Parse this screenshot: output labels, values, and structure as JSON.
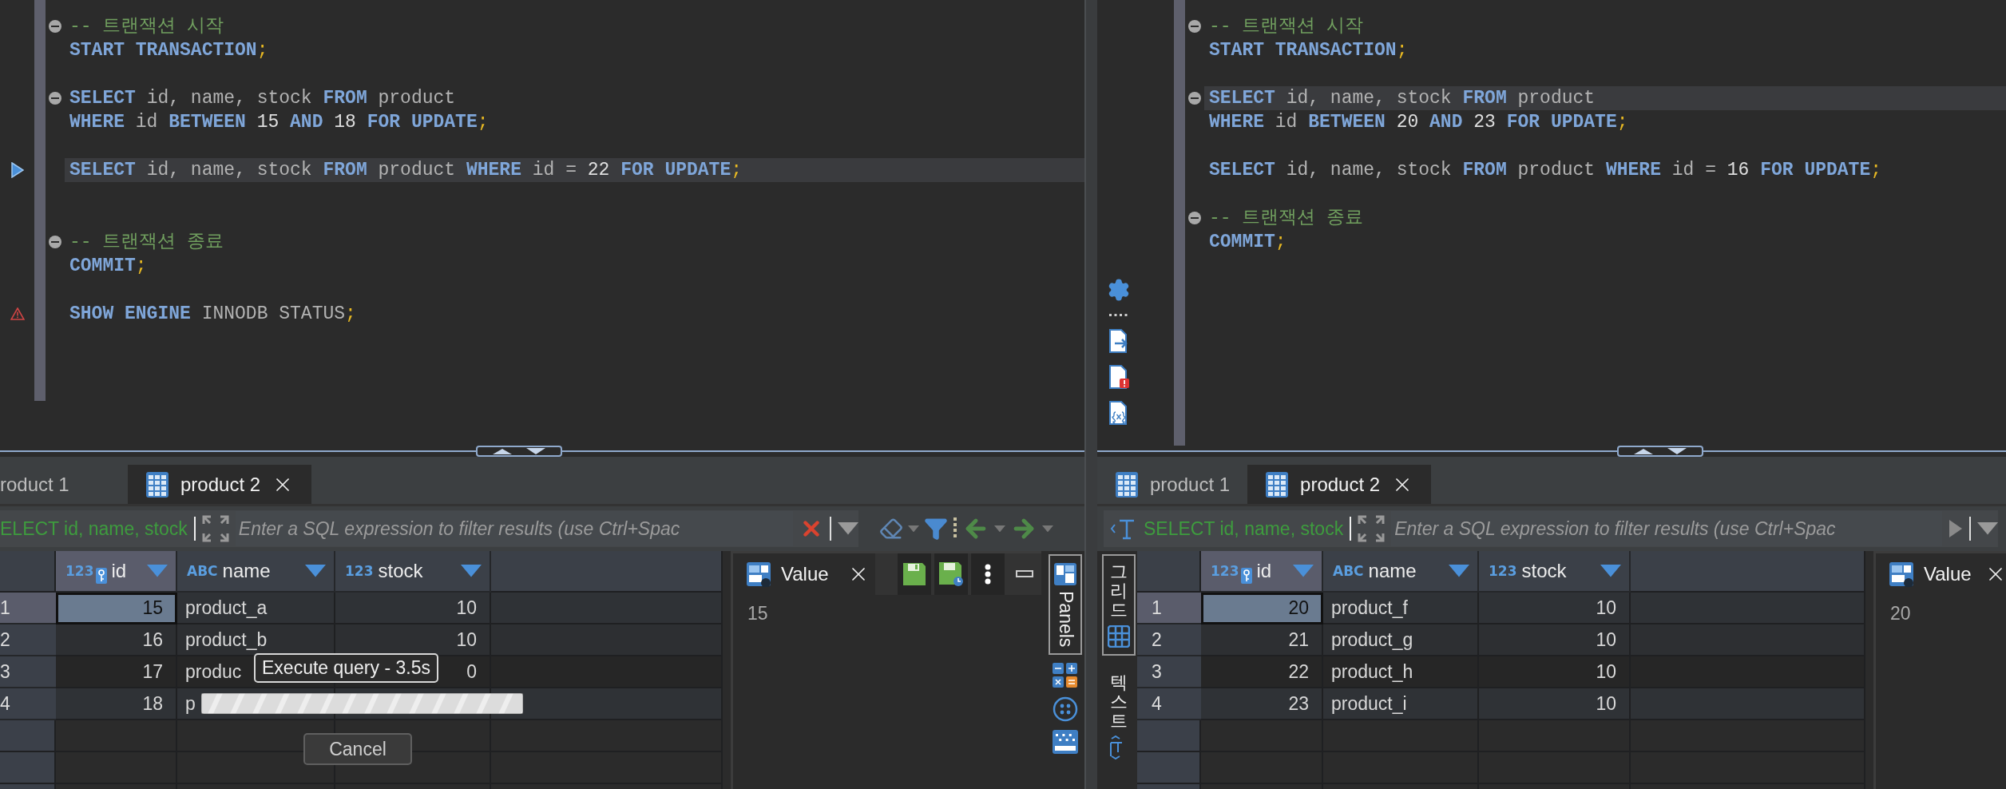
{
  "panes": [
    {
      "editor": {
        "lines": [
          {
            "kind": "code",
            "fold": true,
            "current": false,
            "tokens": [
              {
                "kind": "comment",
                "text": "-- 트랜잭션 시작"
              }
            ]
          },
          {
            "kind": "code",
            "fold": false,
            "current": false,
            "tokens": [
              {
                "kind": "keyword",
                "text": "START TRANSACTION"
              },
              {
                "kind": "punct",
                "text": ";"
              }
            ]
          },
          {
            "kind": "blank"
          },
          {
            "kind": "code",
            "fold": true,
            "current": false,
            "tokens": [
              {
                "kind": "keyword",
                "text": "SELECT"
              },
              {
                "kind": "plain",
                "text": " id, name, stock "
              },
              {
                "kind": "keyword",
                "text": "FROM"
              },
              {
                "kind": "plain",
                "text": " product"
              }
            ]
          },
          {
            "kind": "code",
            "fold": false,
            "current": false,
            "tokens": [
              {
                "kind": "keyword",
                "text": "WHERE"
              },
              {
                "kind": "plain",
                "text": " id "
              },
              {
                "kind": "keyword",
                "text": "BETWEEN "
              },
              {
                "kind": "number",
                "text": "15"
              },
              {
                "kind": "keyword",
                "text": " AND "
              },
              {
                "kind": "number",
                "text": "18"
              },
              {
                "kind": "keyword",
                "text": " FOR UPDATE"
              },
              {
                "kind": "punct",
                "text": ";"
              }
            ]
          },
          {
            "kind": "blank"
          },
          {
            "kind": "code",
            "fold": false,
            "current": true,
            "marker": {
              "kind": "run"
            },
            "tokens": [
              {
                "kind": "keyword",
                "text": "SELECT"
              },
              {
                "kind": "plain",
                "text": " id, name, stock "
              },
              {
                "kind": "keyword",
                "text": "FROM"
              },
              {
                "kind": "plain",
                "text": " product "
              },
              {
                "kind": "keyword",
                "text": "WHERE"
              },
              {
                "kind": "plain",
                "text": " id = "
              },
              {
                "kind": "number",
                "text": "22"
              },
              {
                "kind": "keyword",
                "text": " FOR UPDATE"
              },
              {
                "kind": "punct",
                "text": ";"
              }
            ]
          },
          {
            "kind": "blank"
          },
          {
            "kind": "blank"
          },
          {
            "kind": "code",
            "fold": true,
            "current": false,
            "tokens": [
              {
                "kind": "comment",
                "text": "-- 트랜잭션 종료"
              }
            ]
          },
          {
            "kind": "code",
            "fold": false,
            "current": false,
            "tokens": [
              {
                "kind": "keyword",
                "text": "COMMIT"
              },
              {
                "kind": "punct",
                "text": ";"
              }
            ]
          },
          {
            "kind": "blank"
          },
          {
            "kind": "code",
            "fold": false,
            "current": false,
            "marker": {
              "kind": "warning"
            },
            "tokens": [
              {
                "kind": "keyword",
                "text": "SHOW ENGINE"
              },
              {
                "kind": "plain",
                "text": " INNODB STATUS"
              },
              {
                "kind": "punct",
                "text": ";"
              }
            ]
          }
        ]
      },
      "results": {
        "tabs": [
          {
            "label": "roduct 1",
            "selected": false,
            "icon": false
          },
          {
            "label": "product 2",
            "selected": true,
            "icon": true
          }
        ],
        "filter": {
          "query": "ELECT id, name, stock",
          "placeholder": "Enter a SQL expression to filter results (use Ctrl+Spac",
          "action": {
            "kind": "clear"
          },
          "toolbar": [
            {
              "kind": "eraser"
            },
            {
              "kind": "filter"
            },
            {
              "kind": "more"
            },
            {
              "kind": "back"
            },
            {
              "kind": "forward"
            }
          ]
        },
        "grid": {
          "columns": [
            {
              "label": "id",
              "type_label": "123",
              "key": true,
              "selected": true
            },
            {
              "label": "name",
              "type_label": "ABC",
              "key": false,
              "selected": false
            },
            {
              "label": "stock",
              "type_label": "123",
              "key": false,
              "selected": false
            }
          ],
          "rows": [
            {
              "number": "1",
              "cells": [
                "15",
                "product_a",
                "10"
              ],
              "selected": true
            },
            {
              "number": "2",
              "cells": [
                "16",
                "product_b",
                "10"
              ],
              "selected": false
            },
            {
              "number": "3",
              "cells": [
                "17",
                "produc",
                "0"
              ],
              "selected": false
            },
            {
              "number": "4",
              "cells": [
                "18",
                "p",
                ""
              ],
              "selected": false
            }
          ]
        },
        "progress": {
          "message": "Execute query - 3.5s",
          "button": "Cancel"
        },
        "value_panel": {
          "title": "Value",
          "value": "15",
          "actions": [
            {
              "kind": "save"
            },
            {
              "kind": "save_scheduled"
            },
            {
              "kind": "more"
            },
            {
              "kind": "minimize"
            }
          ]
        },
        "panels_tab": {
          "label": "Panels"
        }
      }
    },
    {
      "side_toolbar": [
        {
          "kind": "settings"
        },
        {
          "kind": "dots"
        },
        {
          "kind": "file_arrow"
        },
        {
          "kind": "file_error"
        },
        {
          "kind": "file_variable"
        }
      ],
      "editor": {
        "lines": [
          {
            "kind": "code",
            "fold": true,
            "current": false,
            "tokens": [
              {
                "kind": "comment",
                "text": "-- 트랜잭션 시작"
              }
            ]
          },
          {
            "kind": "code",
            "fold": false,
            "current": false,
            "tokens": [
              {
                "kind": "keyword",
                "text": "START TRANSACTION"
              },
              {
                "kind": "punct",
                "text": ";"
              }
            ]
          },
          {
            "kind": "blank"
          },
          {
            "kind": "code",
            "fold": true,
            "current": true,
            "tokens": [
              {
                "kind": "keyword",
                "text": "SELECT"
              },
              {
                "kind": "plain",
                "text": " id, name, stock "
              },
              {
                "kind": "keyword",
                "text": "FROM"
              },
              {
                "kind": "plain",
                "text": " product"
              }
            ]
          },
          {
            "kind": "code",
            "fold": false,
            "current": false,
            "tokens": [
              {
                "kind": "keyword",
                "text": "WHERE"
              },
              {
                "kind": "plain",
                "text": " id "
              },
              {
                "kind": "keyword",
                "text": "BETWEEN "
              },
              {
                "kind": "number",
                "text": "20"
              },
              {
                "kind": "keyword",
                "text": " AND "
              },
              {
                "kind": "number",
                "text": "23"
              },
              {
                "kind": "keyword",
                "text": " FOR UPDATE"
              },
              {
                "kind": "punct",
                "text": ";"
              }
            ]
          },
          {
            "kind": "blank"
          },
          {
            "kind": "code",
            "fold": false,
            "current": false,
            "tokens": [
              {
                "kind": "keyword",
                "text": "SELECT"
              },
              {
                "kind": "plain",
                "text": " id, name, stock "
              },
              {
                "kind": "keyword",
                "text": "FROM"
              },
              {
                "kind": "plain",
                "text": " product "
              },
              {
                "kind": "keyword",
                "text": "WHERE"
              },
              {
                "kind": "plain",
                "text": " id = "
              },
              {
                "kind": "number",
                "text": "16"
              },
              {
                "kind": "keyword",
                "text": " FOR UPDATE"
              },
              {
                "kind": "punct",
                "text": ";"
              }
            ]
          },
          {
            "kind": "blank"
          },
          {
            "kind": "code",
            "fold": true,
            "current": false,
            "tokens": [
              {
                "kind": "comment",
                "text": "-- 트랜잭션 종료"
              }
            ]
          },
          {
            "kind": "code",
            "fold": false,
            "current": false,
            "tokens": [
              {
                "kind": "keyword",
                "text": "COMMIT"
              },
              {
                "kind": "punct",
                "text": ";"
              }
            ]
          }
        ]
      },
      "results": {
        "tabs": [
          {
            "label": "product 1",
            "selected": false,
            "icon": true
          },
          {
            "label": "product 2",
            "selected": true,
            "icon": true
          }
        ],
        "filter": {
          "query": "SELECT id, name, stock",
          "placeholder": "Enter a SQL expression to filter results (use Ctrl+Spac",
          "action": {
            "kind": "run"
          }
        },
        "view_switch": [
          {
            "label": "그리드",
            "selected": true,
            "kind": "grid"
          },
          {
            "label": "텍스트",
            "selected": false,
            "kind": "text"
          }
        ],
        "grid": {
          "columns": [
            {
              "label": "id",
              "type_label": "123",
              "key": true,
              "selected": true
            },
            {
              "label": "name",
              "type_label": "ABC",
              "key": false,
              "selected": false
            },
            {
              "label": "stock",
              "type_label": "123",
              "key": false,
              "selected": false
            }
          ],
          "rows": [
            {
              "number": "1",
              "cells": [
                "20",
                "product_f",
                "10"
              ],
              "selected": true
            },
            {
              "number": "2",
              "cells": [
                "21",
                "product_g",
                "10"
              ],
              "selected": false
            },
            {
              "number": "3",
              "cells": [
                "22",
                "product_h",
                "10"
              ],
              "selected": false
            },
            {
              "number": "4",
              "cells": [
                "23",
                "product_i",
                "10"
              ],
              "selected": false
            }
          ]
        },
        "value_panel": {
          "title": "Value",
          "value": "20"
        }
      }
    }
  ]
}
